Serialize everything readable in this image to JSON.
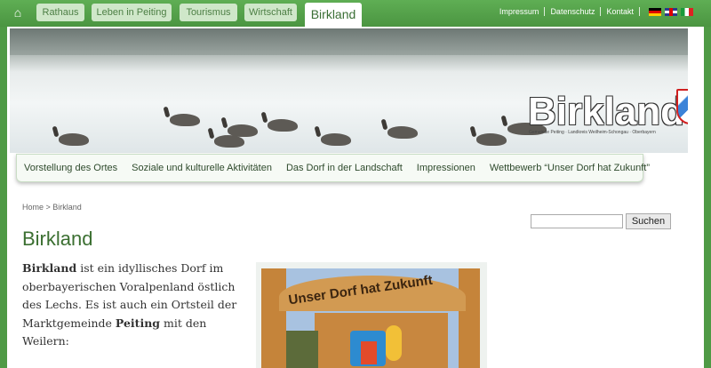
{
  "topnav": {
    "home_icon": "home-icon",
    "tabs": [
      {
        "label": "Rathaus"
      },
      {
        "label": "Leben in Peiting"
      },
      {
        "label": "Tourismus"
      },
      {
        "label": "Wirtschaft"
      },
      {
        "label": "Birkland"
      }
    ],
    "utility_links": [
      "Impressum",
      "Datenschutz",
      "Kontakt"
    ],
    "languages": [
      "de-flag-icon",
      "gb-flag-icon",
      "it-flag-icon"
    ]
  },
  "hero": {
    "logo_text": "Birkland",
    "logo_subtext": "Gemeinde Peiting · Landkreis Weilheim-Schongau · Oberbayern"
  },
  "subnav": {
    "items": [
      "Vorstellung des Ortes",
      "Soziale und kulturelle Aktivitäten",
      "Das Dorf in der Landschaft",
      "Impressionen",
      "Wettbewerb “Unser Dorf hat Zukunft”"
    ]
  },
  "breadcrumb": "Home > Birkland",
  "search": {
    "button_label": "Suchen",
    "value": ""
  },
  "main": {
    "title": "Birkland",
    "intro_bold1": "Birkland",
    "intro_part1": " ist ein idyllisches Dorf im oberbayerischen Voralpenland östlich des Lechs. Es ist auch ein Ortsteil der Marktgemeinde ",
    "intro_bold2": "Peiting",
    "intro_part2": " mit den Weilern:",
    "photo_sign_text": "Unser Dorf hat Zukunft"
  },
  "colors": {
    "brand_green": "#4f9a45",
    "title_green": "#3b6f31"
  }
}
